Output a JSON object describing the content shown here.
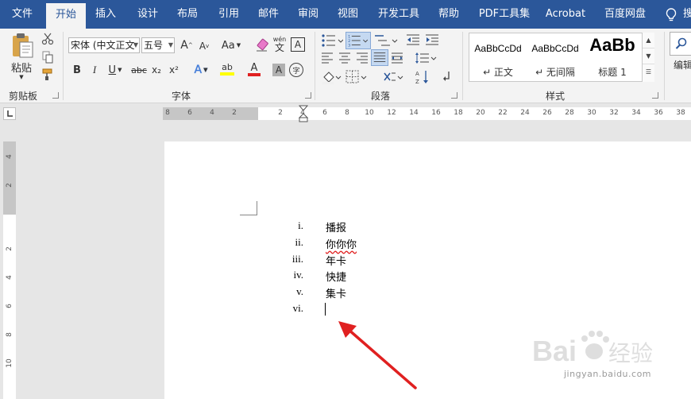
{
  "tabs": [
    {
      "label": "文件",
      "active": false
    },
    {
      "label": "开始",
      "active": true
    },
    {
      "label": "插入",
      "active": false
    },
    {
      "label": "设计",
      "active": false
    },
    {
      "label": "布局",
      "active": false
    },
    {
      "label": "引用",
      "active": false
    },
    {
      "label": "邮件",
      "active": false
    },
    {
      "label": "审阅",
      "active": false
    },
    {
      "label": "视图",
      "active": false
    },
    {
      "label": "开发工具",
      "active": false
    },
    {
      "label": "帮助",
      "active": false
    },
    {
      "label": "PDF工具集",
      "active": false
    },
    {
      "label": "Acrobat",
      "active": false
    },
    {
      "label": "百度网盘",
      "active": false
    }
  ],
  "tab_cut": "搜",
  "clipboard": {
    "paste_label": "粘贴",
    "group_label": "剪贴板"
  },
  "font": {
    "font_name": "宋体 (中文正文",
    "font_size": "五号",
    "grow": "A",
    "shrink": "A",
    "change_case": "Aa",
    "phonetic": "wén",
    "phonetic_char": "文",
    "border_char": "A",
    "bold": "B",
    "italic": "I",
    "underline": "U",
    "strike": "abc",
    "subscript": "x₂",
    "superscript": "x²",
    "effects": "A",
    "highlight": "ab",
    "font_color": "A",
    "char_shade": "A",
    "enclose": "字",
    "group_label": "字体"
  },
  "paragraph": {
    "group_label": "段落"
  },
  "styles": {
    "items": [
      {
        "preview": "AaBbCcDd",
        "name": "↵ 正文"
      },
      {
        "preview": "AaBbCcDd",
        "name": "↵ 无间隔"
      },
      {
        "preview": "AaBb",
        "name": "标题 1"
      }
    ],
    "group_label": "样式"
  },
  "editing": {
    "label": "编辑"
  },
  "ruler": {
    "h_left": [
      "8",
      "6",
      "4",
      "2"
    ],
    "h_right": [
      "2",
      "4",
      "6",
      "8",
      "10",
      "12",
      "14",
      "16",
      "18",
      "20",
      "22",
      "24",
      "26",
      "28",
      "30",
      "32",
      "34",
      "36",
      "38"
    ],
    "v_top": [
      "4",
      "2"
    ],
    "v_body": [
      "2",
      "4",
      "6",
      "8",
      "10"
    ]
  },
  "document": {
    "list": [
      {
        "num": "i.",
        "text": "播报",
        "error": false
      },
      {
        "num": "ii.",
        "text": "你你你",
        "error": true
      },
      {
        "num": "iii.",
        "text": "年卡",
        "error": false
      },
      {
        "num": "iv.",
        "text": "快捷",
        "error": false
      },
      {
        "num": "v.",
        "text": "集卡",
        "error": false
      },
      {
        "num": "vi.",
        "text": "",
        "error": false
      }
    ]
  },
  "watermark": {
    "brand_left": "Bai",
    "brand_right": "经验",
    "url": "jingyan.baidu.com"
  },
  "colors": {
    "tabbar": "#2b579a",
    "highlight": "#ffff00",
    "font_color": "#e02020",
    "arrow": "#e02020"
  },
  "icons": [
    "paste-icon",
    "cut-icon",
    "copy-icon",
    "format-painter-icon",
    "clear-format-icon",
    "bullets-icon",
    "numbering-icon",
    "multilevel-icon",
    "decrease-indent-icon",
    "increase-indent-icon",
    "align-left-icon",
    "center-icon",
    "align-right-icon",
    "justify-icon",
    "distributed-icon",
    "line-spacing-icon",
    "shading-icon",
    "borders-icon",
    "chinese-layout-icon",
    "sort-icon",
    "show-marks-icon",
    "search-icon",
    "lightbulb-icon"
  ]
}
